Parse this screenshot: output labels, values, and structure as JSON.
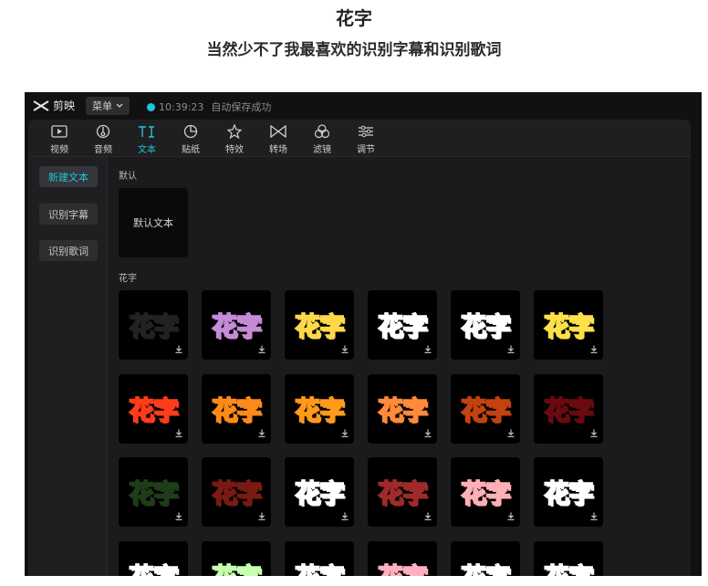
{
  "header": {
    "title": "花字",
    "subtitle": "当然少不了我最喜欢的识别字幕和识别歌词"
  },
  "app": {
    "name": "剪映",
    "menu_label": "菜单",
    "status_time": "10:39:23",
    "status_text": "自动保存成功",
    "accent_color": "#29c2d4"
  },
  "toolbar": {
    "items": [
      {
        "label": "视频",
        "icon": "video-icon",
        "active": false
      },
      {
        "label": "音频",
        "icon": "audio-icon",
        "active": false
      },
      {
        "label": "文本",
        "icon": "text-icon",
        "active": true
      },
      {
        "label": "贴纸",
        "icon": "sticker-icon",
        "active": false
      },
      {
        "label": "特效",
        "icon": "effects-icon",
        "active": false
      },
      {
        "label": "转场",
        "icon": "transition-icon",
        "active": false
      },
      {
        "label": "滤镜",
        "icon": "filter-icon",
        "active": false
      },
      {
        "label": "调节",
        "icon": "adjust-icon",
        "active": false
      }
    ]
  },
  "sidebar": {
    "items": [
      {
        "label": "新建文本",
        "active": true
      },
      {
        "label": "识别字幕",
        "active": false
      },
      {
        "label": "识别歌词",
        "active": false
      }
    ]
  },
  "content": {
    "default_section_label": "默认",
    "default_tile_label": "默认文本",
    "fancy_section_label": "花字",
    "fancy_tile_text": "花字",
    "download_icon": "download-icon",
    "fancy_styles": [
      {
        "fill": "#ffffff",
        "stroke": "#222222"
      },
      {
        "fill": "#ffd6f0",
        "stroke": "#c68bd6"
      },
      {
        "fill": "#ff5a1f",
        "stroke": "#ffd84a"
      },
      {
        "fill": "#ff2a2a",
        "stroke": "#ffffff"
      },
      {
        "fill": "#ff8c8c",
        "stroke": "#ffffff"
      },
      {
        "fill": "#ff6a1a",
        "stroke": "#ffe04a"
      },
      {
        "fill": "#ffe81a",
        "stroke": "#ff3c1a"
      },
      {
        "fill": "#ff2a1a",
        "stroke": "#ff8a1a"
      },
      {
        "fill": "#ffcc22",
        "stroke": "#ff9a1a"
      },
      {
        "fill": "#ff5a2a",
        "stroke": "#ff8a3a"
      },
      {
        "fill": "#ff7a1a",
        "stroke": "#c4420f"
      },
      {
        "fill": "#e0182a",
        "stroke": "#6a0a10"
      },
      {
        "fill": "#5aa846",
        "stroke": "#1f3d18"
      },
      {
        "fill": "#ff4a3a",
        "stroke": "#7a1a12"
      },
      {
        "fill": "#9ecbff",
        "stroke": "#ffffff"
      },
      {
        "fill": "#ff9aa0",
        "stroke": "#a02a2a"
      },
      {
        "fill": "#b8323c",
        "stroke": "#ffb0b6"
      },
      {
        "fill": "#2c8a3e",
        "stroke": "#ffffff"
      },
      {
        "fill": "#f3b0c8",
        "stroke": "#ffffff"
      },
      {
        "fill": "#ffffff",
        "stroke": "#c7ffb0"
      },
      {
        "fill": "#dfff9a",
        "stroke": "#ffffff"
      },
      {
        "fill": "#ffffff",
        "stroke": "#ffb0c0"
      },
      {
        "fill": "#c7b6ff",
        "stroke": "#ffffff"
      },
      {
        "fill": "#f0d27a",
        "stroke": "#ffffff"
      }
    ]
  }
}
